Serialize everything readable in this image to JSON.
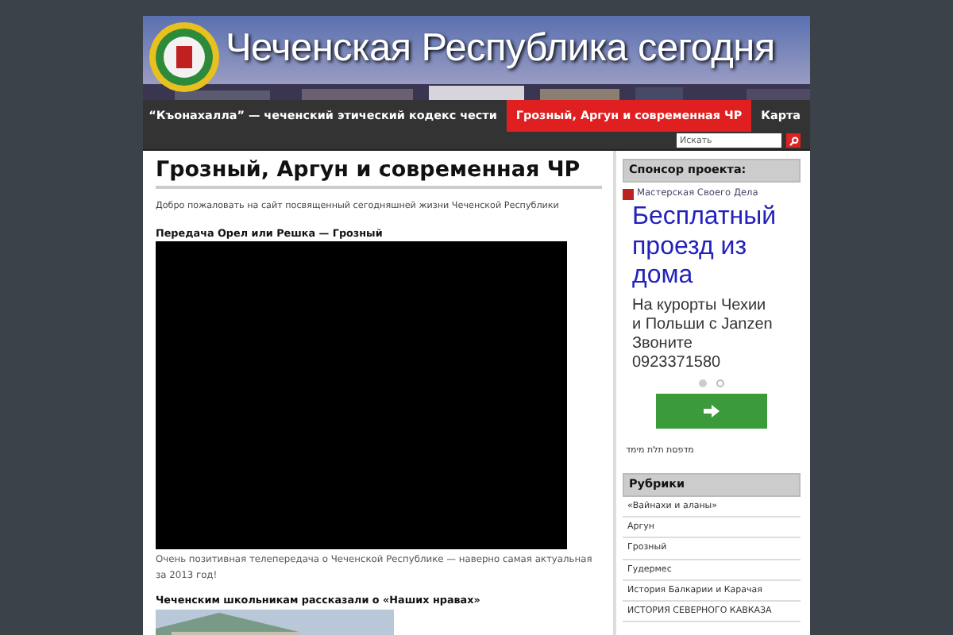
{
  "header": {
    "title": "Чеченская Республика сегодня"
  },
  "nav": [
    {
      "label": "“Къонахалла” — чеченский этический кодекс чести",
      "selected": false
    },
    {
      "label": "Грозный, Аргун и современная ЧР",
      "selected": true
    },
    {
      "label": "Карта",
      "selected": false
    }
  ],
  "search": {
    "placeholder": "Искать"
  },
  "main": {
    "title": "Грозный, Аргун и современная ЧР",
    "intro": "Добро пожаловать на сайт посвященный сегодняшней жизни Чеченской Республики",
    "posts": [
      {
        "title": "Передача Орел или Решка — Грозный",
        "kind": "video",
        "text": "Очень позитивная телепередача о Чеченской Республике — наверно самая актуальная за 2013 год!"
      },
      {
        "title": "Чеченским школьникам рассказали о «Наших нравах»",
        "kind": "picture"
      }
    ]
  },
  "sidebar": {
    "sponsor": {
      "heading": "Спонсор проекта:",
      "advertiser": "Мастерская Своего Дела",
      "headline": "Бесплатный проезд из дома",
      "body": "На курорты Чехии и Польши с Janzen Звоните 0923371580",
      "dots": [
        {
          "selected": true
        },
        {
          "selected": false
        }
      ],
      "footer": "מדפסת תלת מימד"
    },
    "rubrics": {
      "heading": "Рубрики",
      "items": [
        "«Вайнахи и аланы»",
        "Аргун",
        "Грозный",
        "Гудермес",
        "История Балкарии и Карачая",
        "ИСТОРИЯ СЕВЕРНОГО КАВКАЗА"
      ]
    }
  }
}
